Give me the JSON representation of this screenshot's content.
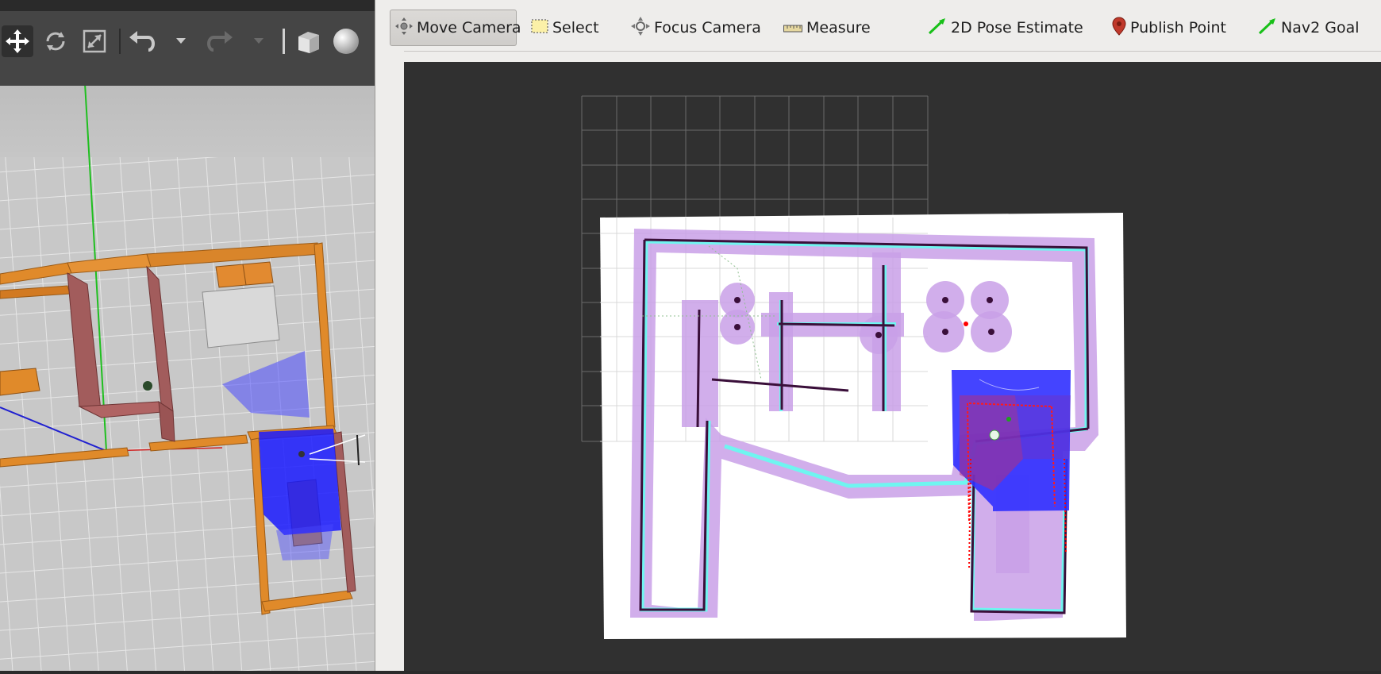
{
  "rviz": {
    "tools": [
      {
        "label": "Move Camera",
        "icon": "move-camera-icon",
        "active": true
      },
      {
        "label": "Select",
        "icon": "select-icon",
        "active": false
      },
      {
        "label": "Focus Camera",
        "icon": "focus-camera-icon",
        "active": false
      },
      {
        "label": "Measure",
        "icon": "measure-icon",
        "active": false
      },
      {
        "label": "2D Pose Estimate",
        "icon": "green-arrow-icon",
        "active": false
      },
      {
        "label": "Publish Point",
        "icon": "map-pin-icon",
        "active": false
      },
      {
        "label": "Nav2 Goal",
        "icon": "green-arrow-icon",
        "active": false
      }
    ]
  },
  "gazebo": {
    "tools": [
      "translate-icon",
      "rotate-icon",
      "scale-icon",
      "undo-icon",
      "undo-dropdown-icon",
      "redo-icon",
      "redo-dropdown-icon",
      "box-shape-icon",
      "sphere-shape-icon"
    ]
  },
  "colors": {
    "costmap_inflation": "#c9a0e8",
    "costmap_inner": "#6ff5f0",
    "wall": "#3a0f3a",
    "local_costmap": "#3030ff",
    "laser": "#ff0000",
    "gazebo_wall": "#e08a2a",
    "gazebo_brick": "#a05a5a",
    "gazebo_ground": "#c8c8c8"
  }
}
